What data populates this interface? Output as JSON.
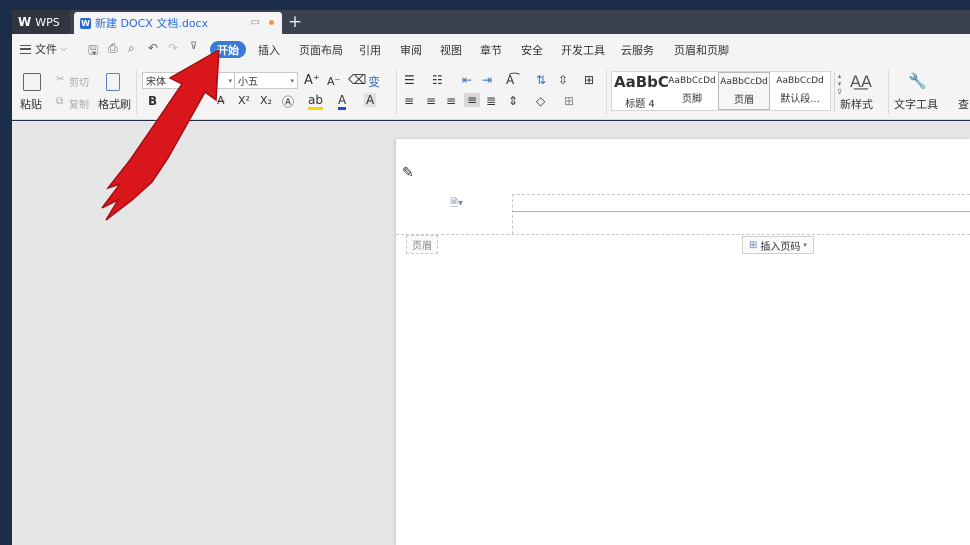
{
  "titlebar": {
    "app_name": "WPS",
    "doc_tab_title": "新建 DOCX 文档.docx",
    "new_tab_symbol": "+"
  },
  "menubar": {
    "file_label": "文件",
    "active_tab": "开始",
    "tabs": [
      "插入",
      "页面布局",
      "引用",
      "审阅",
      "视图",
      "章节",
      "安全",
      "开发工具",
      "云服务",
      "页眉和页脚"
    ]
  },
  "ribbon": {
    "paste": "粘贴",
    "cut": "剪切",
    "copy": "复制",
    "format_painter": "格式刷",
    "font_name": "宋体",
    "font_size": "小五",
    "bold": "B",
    "styles": [
      {
        "sample": "AaBbC",
        "name": "标题 4"
      },
      {
        "sample": "AaBbCcDd",
        "name": "页脚"
      },
      {
        "sample": "AaBbCcDd",
        "name": "页眉"
      },
      {
        "sample": "AaBbCcDd",
        "name": "默认段..."
      }
    ],
    "new_style": "新样式",
    "text_tools": "文字工具",
    "find": "查"
  },
  "document": {
    "header_tag": "页眉",
    "insert_page_number": "插入页码"
  },
  "colors": {
    "accent": "#3a7bd5",
    "arrow": "#d8161c",
    "titlebar": "#3c4150"
  }
}
